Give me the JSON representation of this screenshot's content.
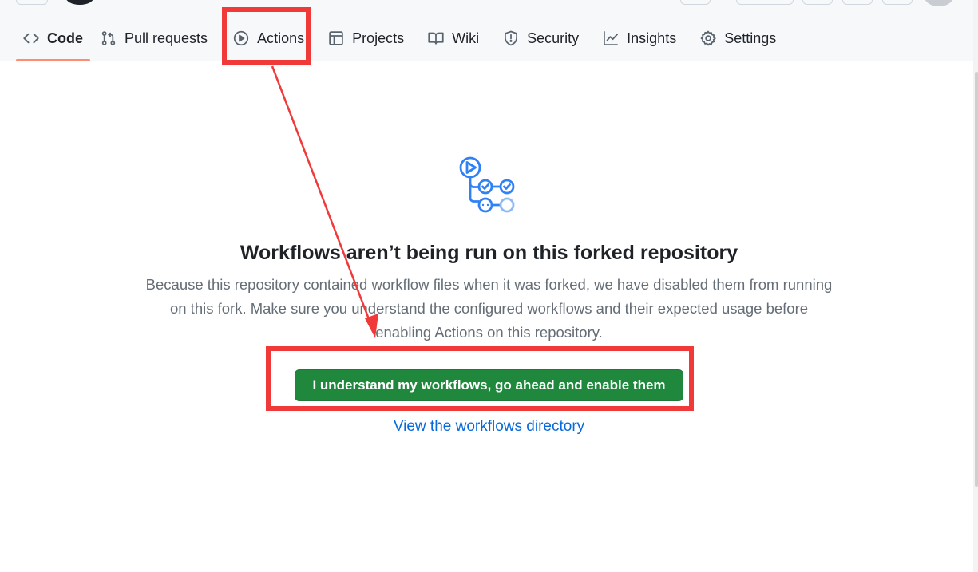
{
  "nav": {
    "tabs": [
      {
        "label": "Code",
        "icon": "code-icon",
        "selected": true
      },
      {
        "label": "Pull requests",
        "icon": "git-pull-request-icon"
      },
      {
        "label": "Actions",
        "icon": "play-icon"
      },
      {
        "label": "Projects",
        "icon": "table-icon"
      },
      {
        "label": "Wiki",
        "icon": "book-icon"
      },
      {
        "label": "Security",
        "icon": "shield-icon"
      },
      {
        "label": "Insights",
        "icon": "graph-icon"
      },
      {
        "label": "Settings",
        "icon": "gear-icon"
      }
    ]
  },
  "blankslate": {
    "icon": "workflow-icon",
    "title": "Workflows aren’t being run on this forked repository",
    "description": "Because this repository contained workflow files when it was forked, we have disabled them from running on this fork. Make sure you understand the configured workflows and their expected usage before enabling Actions on this repository.",
    "enable_button": "I understand my workflows, go ahead and enable them",
    "workflows_link": "View the workflows directory"
  },
  "annotations": {
    "highlight_color": "#f03a3a",
    "boxes": [
      "actions-tab-highlight",
      "enable-button-highlight"
    ],
    "arrow": "arrow-actions-to-enable-button"
  },
  "colors": {
    "accent_underline": "#fd8c73",
    "primary_button": "#1f883d",
    "link": "#0969da",
    "icon_blue": "#2f81f7"
  }
}
